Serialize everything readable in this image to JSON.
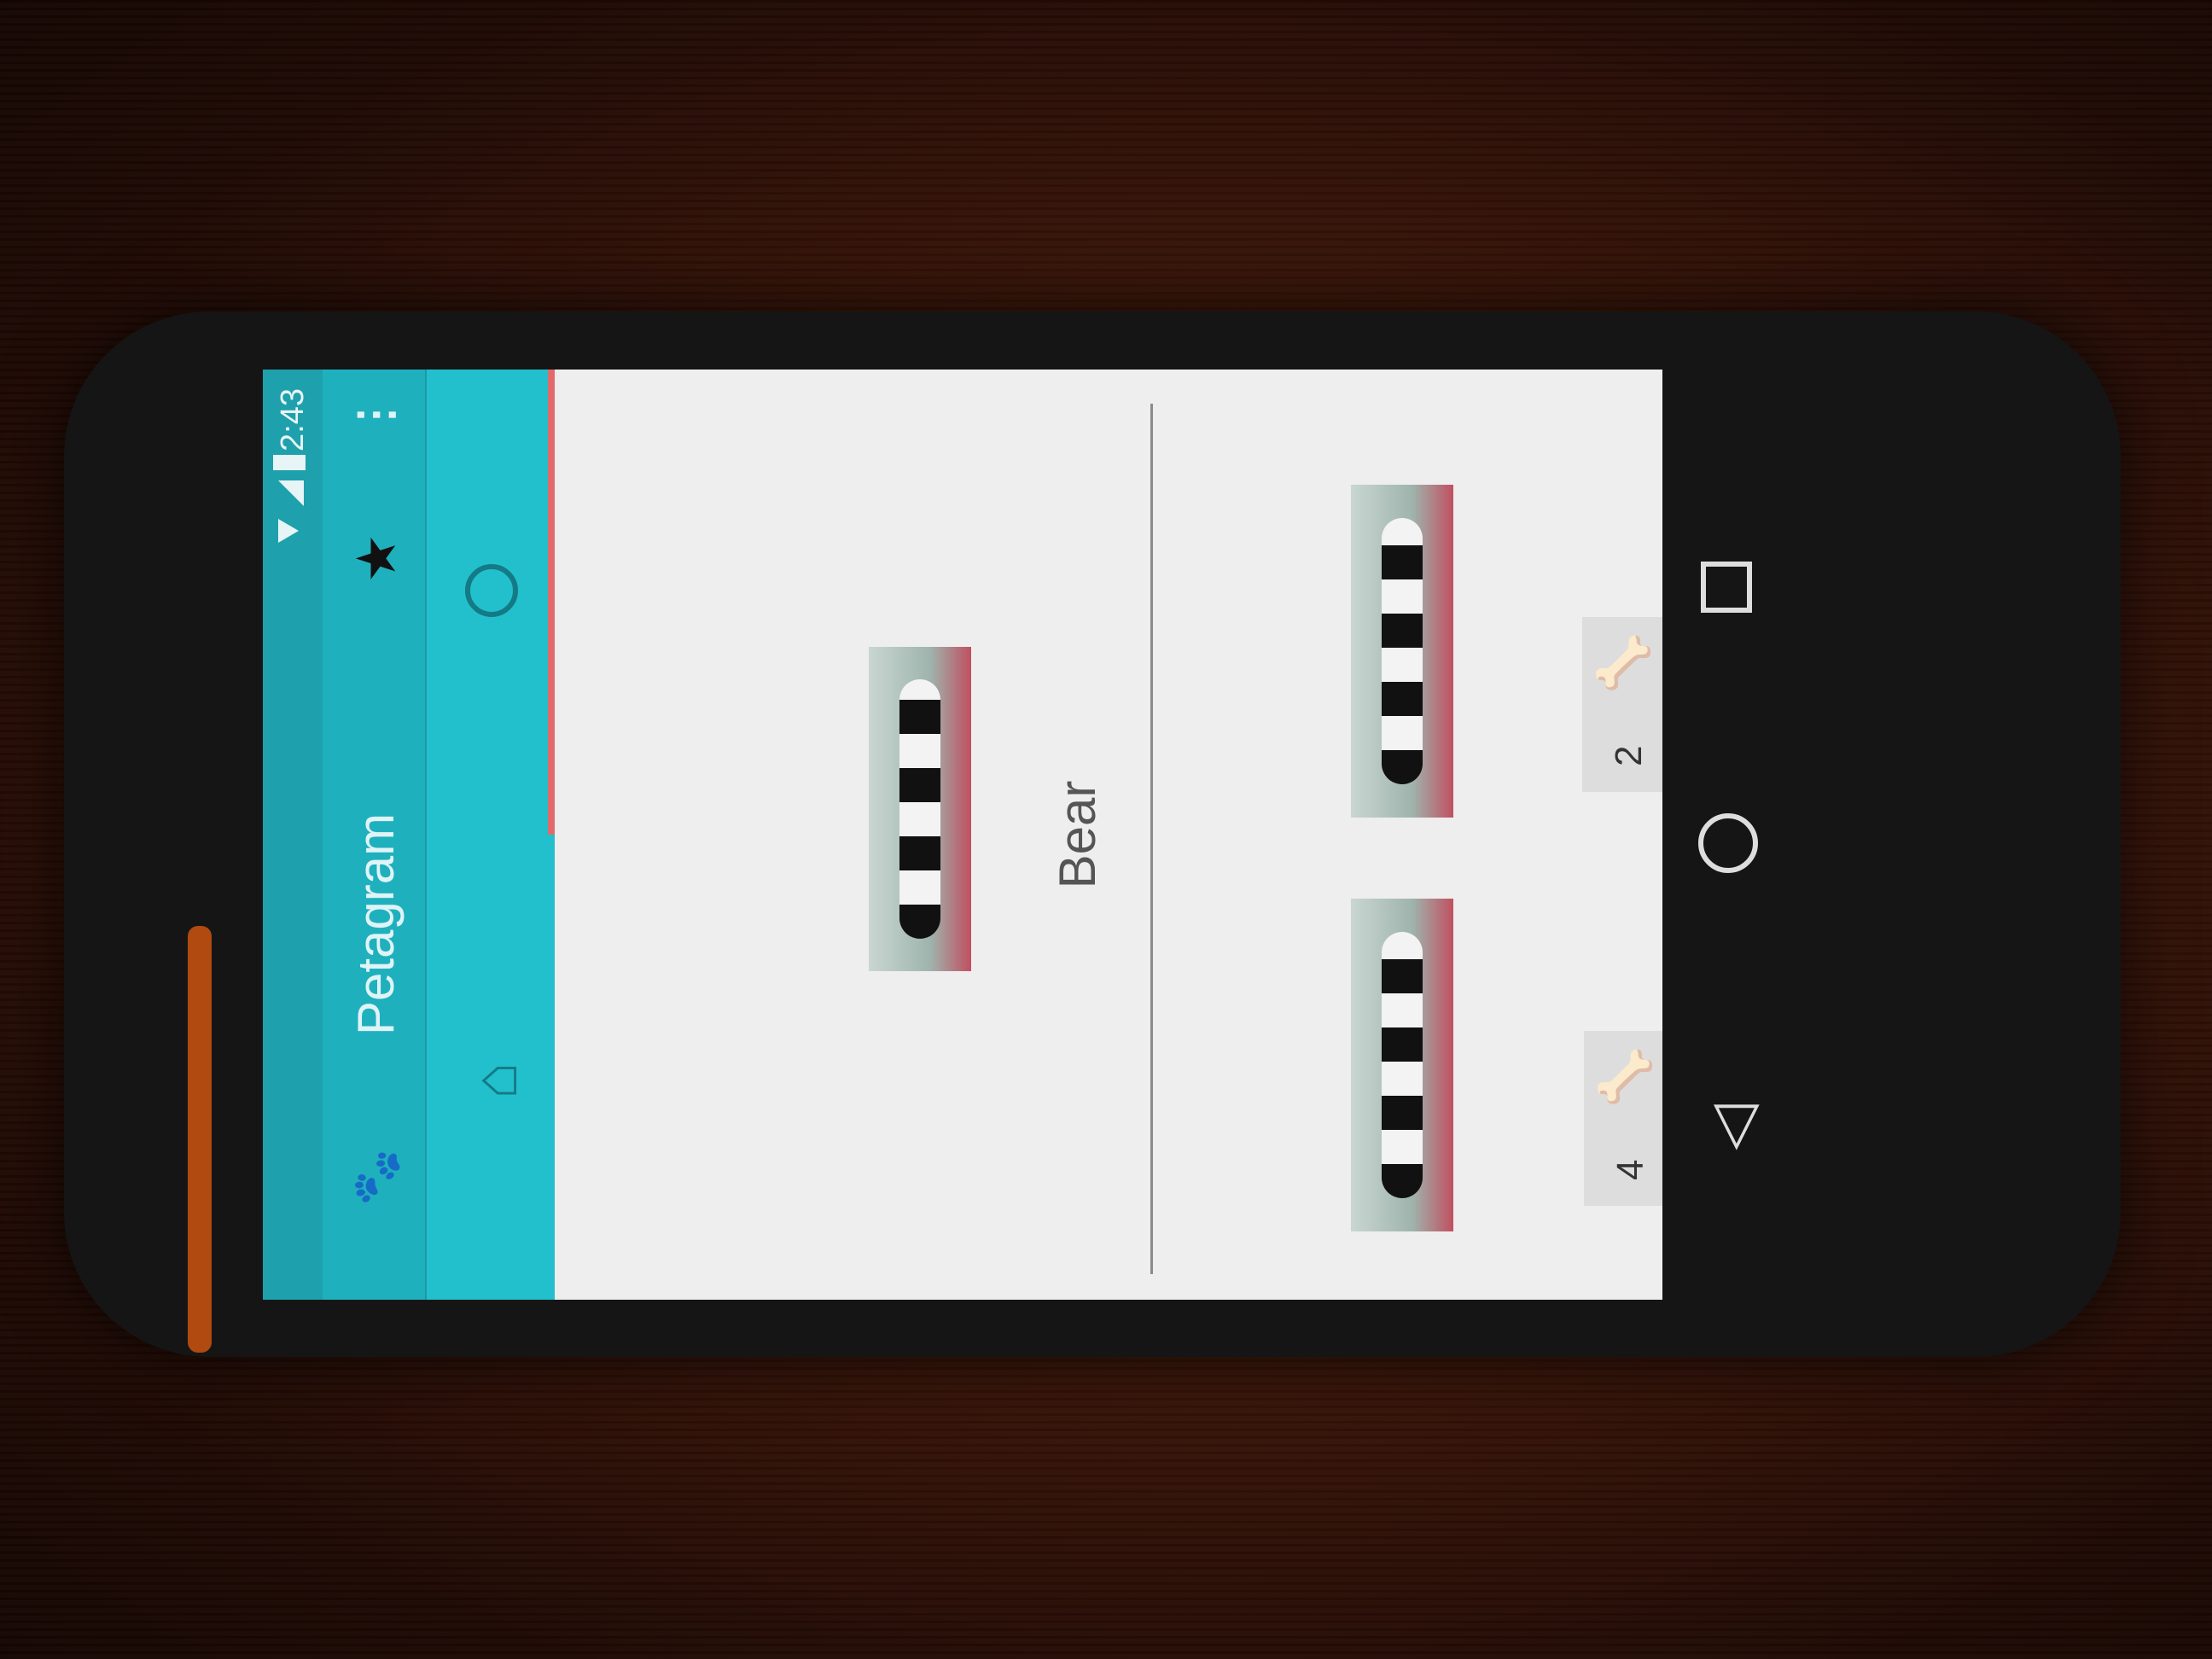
{
  "status_bar": {
    "time": "2:43"
  },
  "app_bar": {
    "title": "Petagram",
    "paw_icon": "paw-icon",
    "star_icon": "star-icon",
    "menu_icon": "more-vert-icon",
    "menu_glyph": "⋮",
    "star_glyph": "★",
    "paw_glyph": "🐾"
  },
  "tabs": [
    {
      "name": "home",
      "icon": "home-icon",
      "glyph": "⌂"
    },
    {
      "name": "profile",
      "icon": "profile-icon",
      "selected": true
    }
  ],
  "profile": {
    "name": "Bear"
  },
  "grid": [
    {
      "likes": "4"
    },
    {
      "likes": "2"
    }
  ],
  "colors": {
    "primary": "#1fb0be",
    "accent": "#e26a6a",
    "bone": "#f07d1a"
  },
  "nav": {
    "back_glyph": "◁"
  }
}
